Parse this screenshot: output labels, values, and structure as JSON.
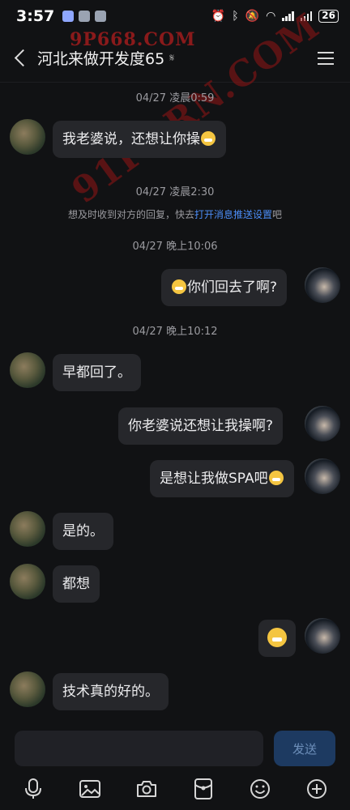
{
  "status_bar": {
    "time": "3:57",
    "battery": "26"
  },
  "header": {
    "title": "河北来做开发度65"
  },
  "watermark": {
    "top": "9P668.COM",
    "diagonal": "91PORN.COM"
  },
  "notice": {
    "prefix": "想及时收到对方的回复，快去",
    "link": "打开消息推送设置",
    "suffix": "吧"
  },
  "timestamps": [
    "04/27 凌晨0:59",
    "04/27 凌晨2:30",
    "04/27 晚上10:06",
    "04/27 晚上10:12"
  ],
  "messages": [
    {
      "side": "left",
      "text": "我老婆说，还想让你操"
    },
    {
      "side": "right",
      "text": "你们回去了啊?"
    },
    {
      "side": "left",
      "text": "早都回了。"
    },
    {
      "side": "right",
      "text": "你老婆说还想让我操啊?"
    },
    {
      "side": "right",
      "text": "是想让我做SPA吧"
    },
    {
      "side": "left",
      "text": "是的。"
    },
    {
      "side": "left",
      "text": "都想"
    },
    {
      "side": "right",
      "text": ""
    },
    {
      "side": "left",
      "text": "技术真的好的。"
    }
  ],
  "input": {
    "send_label": "发送"
  },
  "toolbar_icons": [
    "microphone-icon",
    "image-icon",
    "camera-icon",
    "red-packet-icon",
    "emoji-icon",
    "plus-icon"
  ]
}
